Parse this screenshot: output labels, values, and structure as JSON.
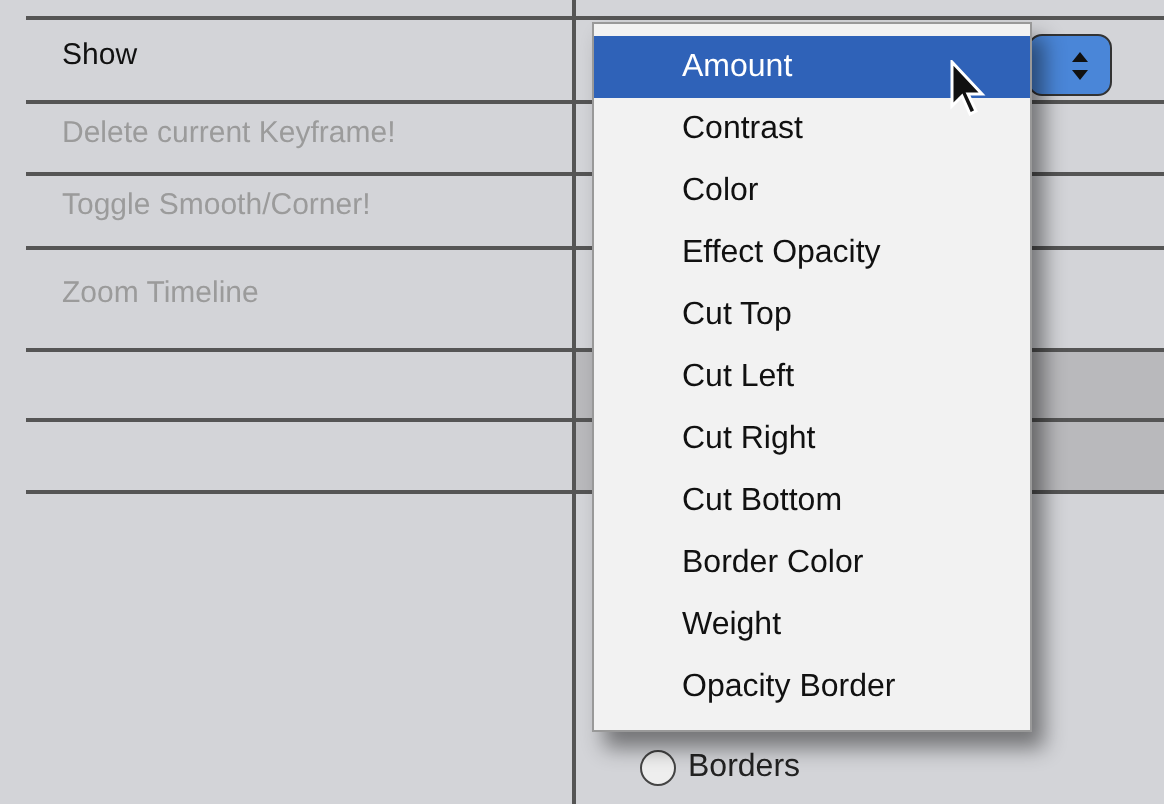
{
  "rows": [
    {
      "label": "Show",
      "disabled": false
    },
    {
      "label": "Delete current Keyframe!",
      "disabled": true
    },
    {
      "label": "Toggle Smooth/Corner!",
      "disabled": true
    },
    {
      "label": "Zoom Timeline",
      "disabled": true
    }
  ],
  "popup_menu": {
    "items": [
      {
        "label": "Amount",
        "selected": true
      },
      {
        "label": "Contrast",
        "selected": false
      },
      {
        "label": "Color",
        "selected": false
      },
      {
        "label": "Effect Opacity",
        "selected": false
      },
      {
        "label": "Cut Top",
        "selected": false
      },
      {
        "label": "Cut Left",
        "selected": false
      },
      {
        "label": "Cut Right",
        "selected": false
      },
      {
        "label": "Cut Bottom",
        "selected": false
      },
      {
        "label": "Border Color",
        "selected": false
      },
      {
        "label": "Weight",
        "selected": false
      },
      {
        "label": "Opacity Border",
        "selected": false
      }
    ]
  },
  "radio": {
    "label": "Borders",
    "selected": false
  }
}
